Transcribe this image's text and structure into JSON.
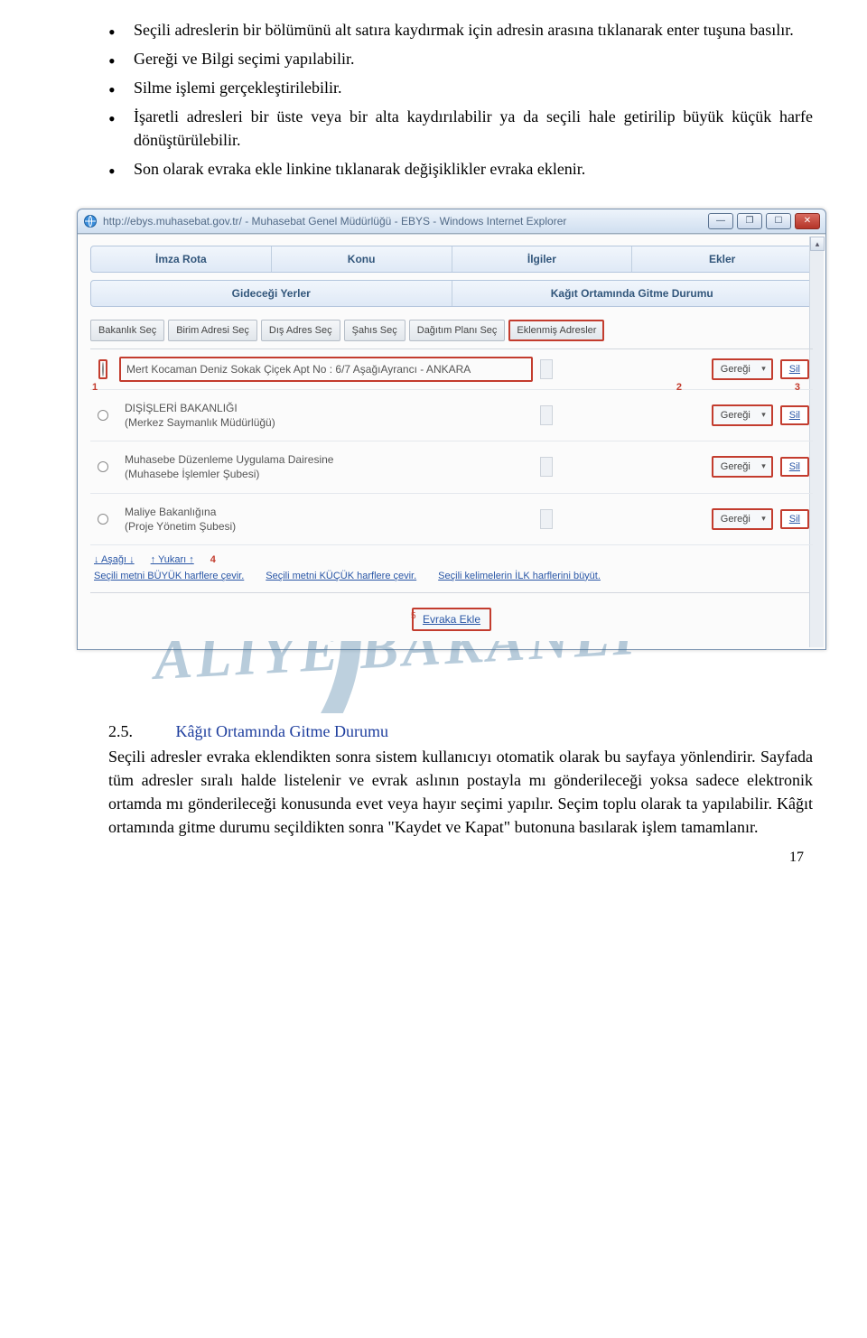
{
  "bullets": [
    "Seçili adreslerin bir bölümünü alt satıra kaydırmak için adresin arasına tıklanarak enter tuşuna basılır.",
    "Gereği ve Bilgi seçimi yapılabilir.",
    "Silme işlemi gerçekleştirilebilir.",
    "İşaretli adresleri bir üste veya bir alta kaydırılabilir ya da seçili hale getirilip büyük küçük harfe dönüştürülebilir.",
    "Son olarak evraka ekle linkine tıklanarak değişiklikler evraka eklenir."
  ],
  "window": {
    "title": "http://ebys.muhasebat.gov.tr/ - Muhasebat Genel Müdürlüğü - EBYS - Windows Internet Explorer"
  },
  "tabs1": [
    "İmza Rota",
    "Konu",
    "İlgiler",
    "Ekler"
  ],
  "tabs2": [
    "Gideceği Yerler",
    "Kağıt Ortamında Gitme Durumu"
  ],
  "filters": [
    "Bakanlık Seç",
    "Birim Adresi Seç",
    "Dış Adres Seç",
    "Şahıs Seç",
    "Dağıtım Planı Seç",
    "Eklenmiş Adresler"
  ],
  "rows": [
    {
      "text": "Mert Kocaman Deniz Sokak Çiçek Apt No : 6/7 AşağıAyrancı - ANKARA",
      "action": "Gereği",
      "del": "Sil"
    },
    {
      "text": "DIŞİŞLERİ BAKANLIĞI\n(Merkez Saymanlık Müdürlüğü)",
      "action": "Gereği",
      "del": "Sil"
    },
    {
      "text": "Muhasebe Düzenleme Uygulama Dairesine\n(Muhasebe İşlemler Şubesi)",
      "action": "Gereği",
      "del": "Sil"
    },
    {
      "text": "Maliye Bakanlığına\n(Proje Yönetim Şubesi)",
      "action": "Gereği",
      "del": "Sil"
    }
  ],
  "moverow": {
    "down": "↓ Aşağı ↓",
    "up": "↑ Yukarı ↑",
    "badge4": "4"
  },
  "convertrow": {
    "upper": "Seçili metni BÜYÜK harflere çevir.",
    "lower": "Seçili metni KÜÇÜK harflere çevir.",
    "first": "Seçili kelimelerin İLK harflerini büyüt."
  },
  "evraka": "Evraka Ekle",
  "badges": {
    "n1": "1",
    "n2": "2",
    "n3": "3",
    "n5": "5"
  },
  "watermark": "ALİYE BAKANLI",
  "section": {
    "num": "2.5.",
    "title": "Kâğıt Ortamında Gitme Durumu"
  },
  "paragraph": "Seçili adresler evraka eklendikten sonra sistem kullanıcıyı otomatik olarak bu sayfaya yönlendirir. Sayfada tüm adresler sıralı halde listelenir ve evrak aslının postayla mı gönderileceği yoksa sadece elektronik ortamda mı gönderileceği konusunda evet veya hayır seçimi yapılır. Seçim toplu olarak ta yapılabilir. Kâğıt ortamında gitme durumu seçildikten sonra \"Kaydet ve Kapat\" butonuna basılarak işlem tamamlanır.",
  "pagenum": "17"
}
